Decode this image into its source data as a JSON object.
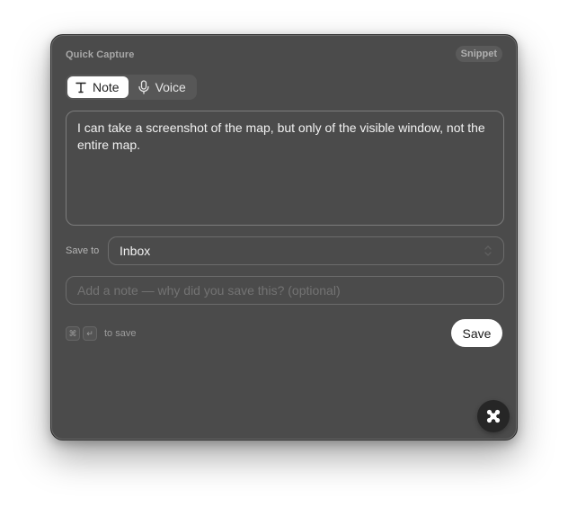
{
  "window": {
    "title": "Quick Capture",
    "badge": "Snippet"
  },
  "modes": [
    {
      "label": "Note",
      "icon": "text-icon",
      "active": true
    },
    {
      "label": "Voice",
      "icon": "microphone-icon",
      "active": false
    }
  ],
  "capture": {
    "text": "I can take a screenshot of the map, but only of the visible window, not the entire map."
  },
  "destination": {
    "label": "Save to",
    "value": "Inbox",
    "icon": "chevron-up-down-icon"
  },
  "note": {
    "placeholder": "Add a note — why did you save this? (optional)",
    "value": ""
  },
  "shortcut": {
    "keys": [
      "⌘",
      "↵"
    ],
    "text": "to save"
  },
  "actions": {
    "save_label": "Save"
  },
  "fab": {
    "icon": "app-logo-icon"
  },
  "colors": {
    "panel": "#4b4b4b",
    "accent": "#ffffff"
  }
}
